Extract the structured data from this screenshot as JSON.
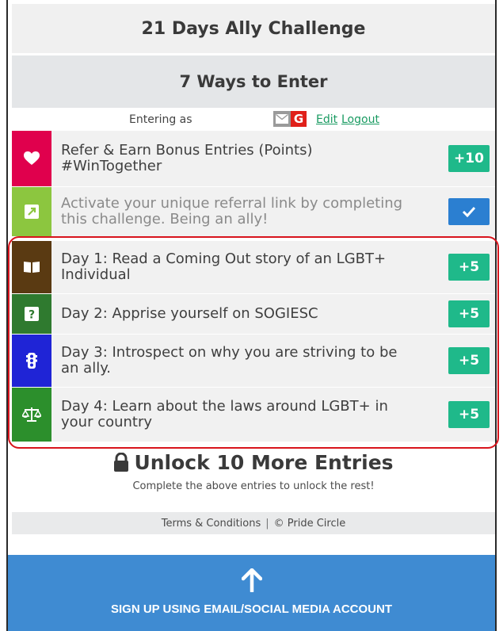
{
  "header": {
    "title": "21 Days Ally Challenge",
    "ways": "7 Ways to Enter"
  },
  "entering": {
    "label": "Entering as",
    "mail_icon": "mail-icon",
    "google_icon": "G",
    "edit": "Edit",
    "logout": "Logout"
  },
  "entries": [
    {
      "text": "Refer & Earn Bonus Entries (Points) #WinTogether",
      "badge": "+10",
      "color": "#e0004d",
      "icon": "heart-icon"
    },
    {
      "text": "Activate your unique referral link by completing this challenge. Being an ally!",
      "badge": "",
      "color": "#8cc63f",
      "icon": "external-link-icon"
    },
    {
      "text": "Day 1: Read a Coming Out story of an LGBT+ Individual",
      "badge": "+5",
      "color": "#5a3a12",
      "icon": "book-icon"
    },
    {
      "text": "Day 2: Apprise yourself on SOGIESC",
      "badge": "+5",
      "color": "#2f7a2f",
      "icon": "question-icon"
    },
    {
      "text": "Day 3: Introspect on why you are striving to be an ally.",
      "badge": "+5",
      "color": "#1f24d6",
      "icon": "traffic-light-icon"
    },
    {
      "text": "Day 4: Learn about the laws around LGBT+ in your country",
      "badge": "+5",
      "color": "#2c8f2c",
      "icon": "scales-icon"
    }
  ],
  "unlock": {
    "title": "Unlock 10 More Entries",
    "subtitle": "Complete the above entries to unlock the rest!"
  },
  "footer": {
    "terms": "Terms & Conditions",
    "separator": "|",
    "copyright": "© Pride Circle"
  },
  "signup": {
    "label": "SIGN UP USING EMAIL/SOCIAL MEDIA ACCOUNT"
  },
  "colors": {
    "badge_green": "#1fb98a",
    "check_blue": "#2b7fd1",
    "signup_blue": "#3f8bd2",
    "highlight_red": "#d8141c"
  }
}
